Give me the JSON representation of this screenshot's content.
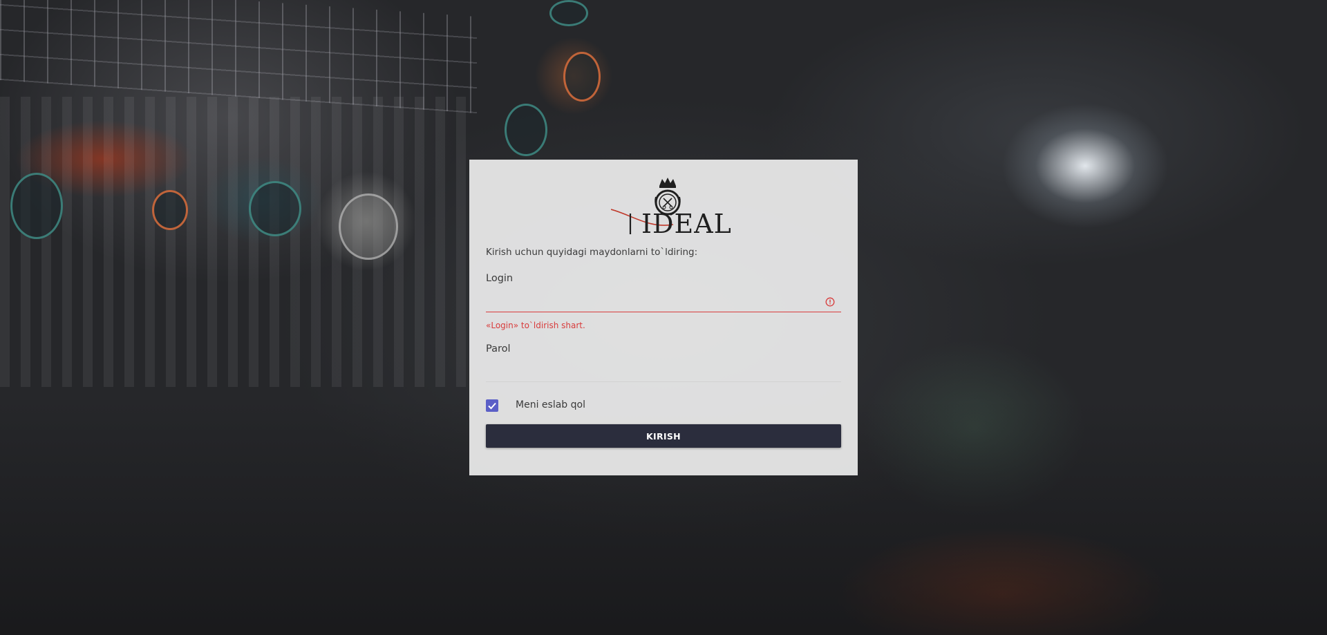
{
  "brand": {
    "logo_text": "IDEAL",
    "colors": {
      "logo_accent": "#c0392b",
      "logo_dark": "#1f1f1f"
    }
  },
  "form": {
    "intro": "Kirish uchun quyidagi maydonlarni to`ldiring:",
    "login": {
      "label": "Login",
      "value": "",
      "error": "«Login» to`ldirish shart.",
      "icon": "error-circle-icon"
    },
    "password": {
      "label": "Parol",
      "value": ""
    },
    "remember": {
      "label": "Meni eslab qol",
      "checked": true
    },
    "submit_label": "KIRISH"
  },
  "colors": {
    "error": "#d83b3b",
    "checkbox": "#5b5fc7",
    "button": "#2b2d3d"
  }
}
